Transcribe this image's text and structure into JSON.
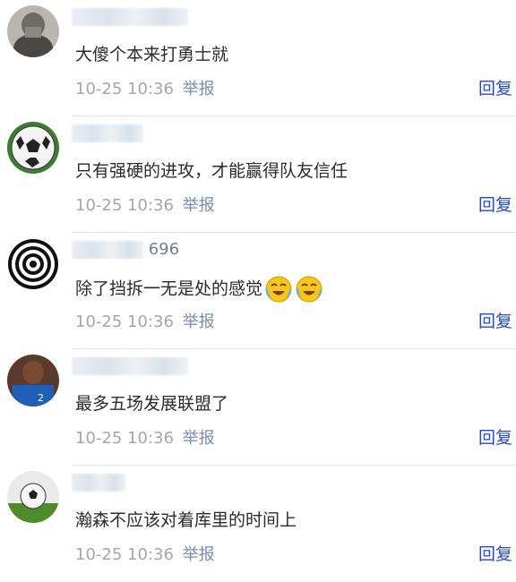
{
  "comments": [
    {
      "username_suffix": "",
      "content": "大傻个本来打勇士就",
      "time": "10-25 10:36",
      "report": "举报",
      "reply": "回复"
    },
    {
      "username_suffix": "",
      "content": "只有强硬的进攻，才能赢得队友信任",
      "time": "10-25 10:36",
      "report": "举报",
      "reply": "回复"
    },
    {
      "username_suffix": "696",
      "content": "除了挡拆一无是处的感觉",
      "time": "10-25 10:36",
      "report": "举报",
      "reply": "回复",
      "emojis": [
        "crying-laughing-emoji",
        "crying-laughing-emoji"
      ]
    },
    {
      "username_suffix": "",
      "content": "最多五场发展联盟了",
      "time": "10-25 10:36",
      "report": "举报",
      "reply": "回复"
    },
    {
      "username_suffix": "",
      "content": "瀚森不应该对着库里的时间上",
      "time": "10-25 10:36",
      "report": "举报",
      "reply": "回复"
    }
  ],
  "colors": {
    "reply": "#2a4bc2",
    "report": "#7c8bb0",
    "timestamp": "#a6a6a6",
    "content": "#2b2b2b",
    "divider": "#e4e4e4"
  }
}
